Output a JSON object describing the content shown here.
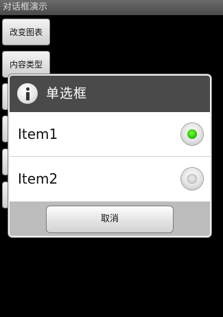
{
  "app": {
    "title": "对话框演示"
  },
  "background_buttons": [
    "改变图表",
    "内容类型"
  ],
  "dialog": {
    "title": "单选框",
    "icon": "info-icon",
    "items": [
      {
        "label": "Item1",
        "checked": true
      },
      {
        "label": "Item2",
        "checked": false
      }
    ],
    "cancel_label": "取消"
  },
  "colors": {
    "selected_radio": "#28c400",
    "header": "#4a4a4a"
  }
}
